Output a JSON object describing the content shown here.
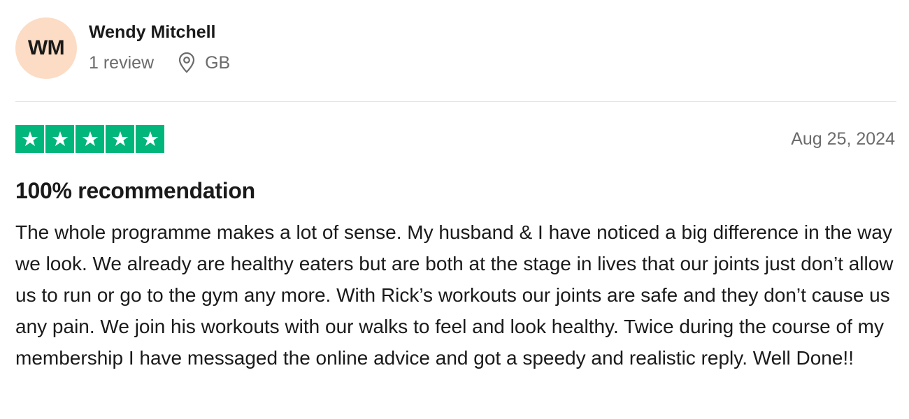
{
  "consumer": {
    "initials": "WM",
    "name": "Wendy Mitchell",
    "review_count": "1 review",
    "country": "GB",
    "avatar_color": "#fcdcc4"
  },
  "review": {
    "rating": 5,
    "max_rating": 5,
    "star_color": "#00b67a",
    "date": "Aug 25, 2024",
    "title": "100% recommendation",
    "text": "The whole programme makes a lot of sense. My husband & I have noticed a big difference in the way we look. We already are healthy eaters but are both at the stage in lives that our joints just don’t allow us to run or go to the gym any more. With Rick’s workouts our joints are safe and they don’t cause us any pain. We join his workouts with our walks to feel and look healthy. Twice during the course of my membership I have messaged the online advice and got a speedy and realistic reply. Well Done!!"
  },
  "icons": {
    "location": "location-pin-icon",
    "star": "star-icon"
  }
}
